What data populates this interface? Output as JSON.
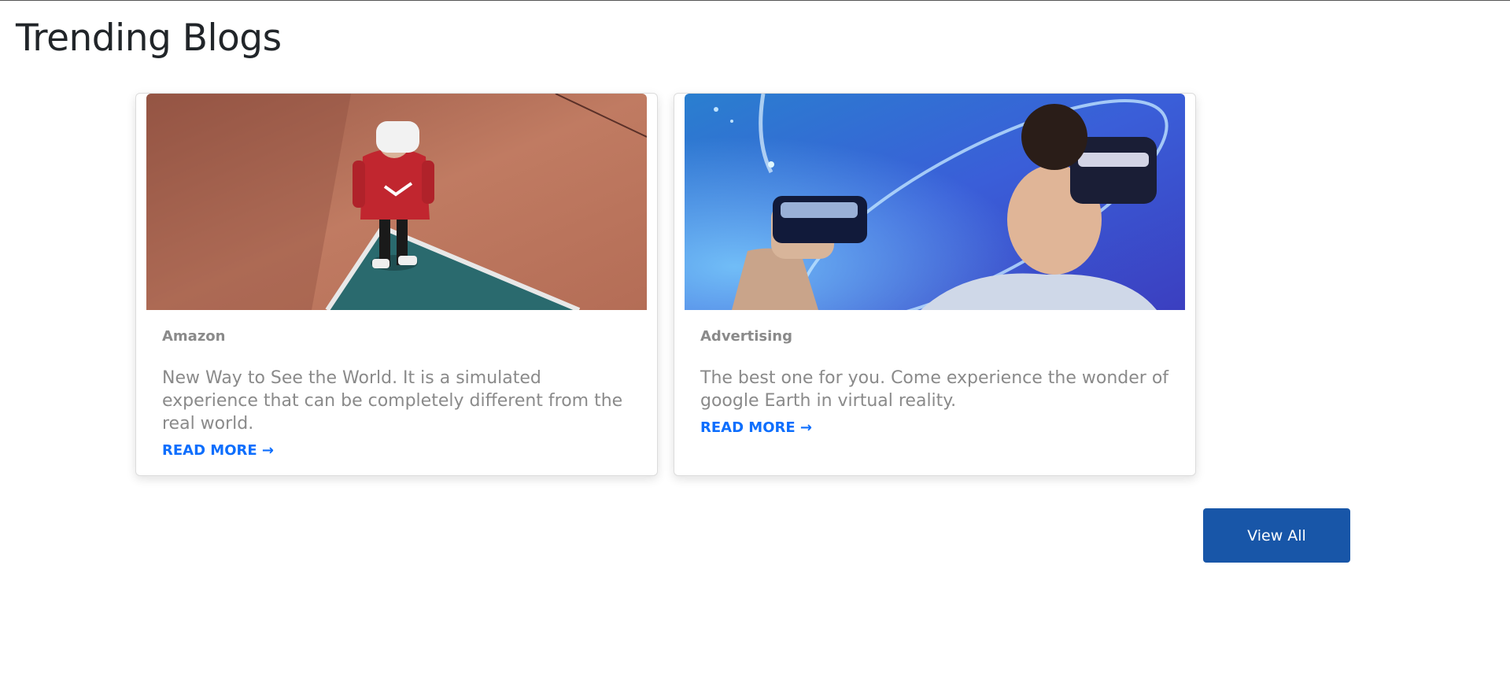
{
  "page": {
    "title": "Trending Blogs"
  },
  "blogs": [
    {
      "category": "Amazon",
      "description": "New Way to See the World. It is a simulated experience that can be completely different from the real world.",
      "read_more": "READ MORE →"
    },
    {
      "category": "Advertising",
      "description": "The best one for you. Come experience the wonder of google Earth in virtual reality.",
      "read_more": "READ MORE →"
    }
  ],
  "actions": {
    "view_all": "View All"
  },
  "colors": {
    "accent": "#0d6efd",
    "button": "#1856a8",
    "muted_text": "#8a8a8a",
    "title": "#212529"
  }
}
